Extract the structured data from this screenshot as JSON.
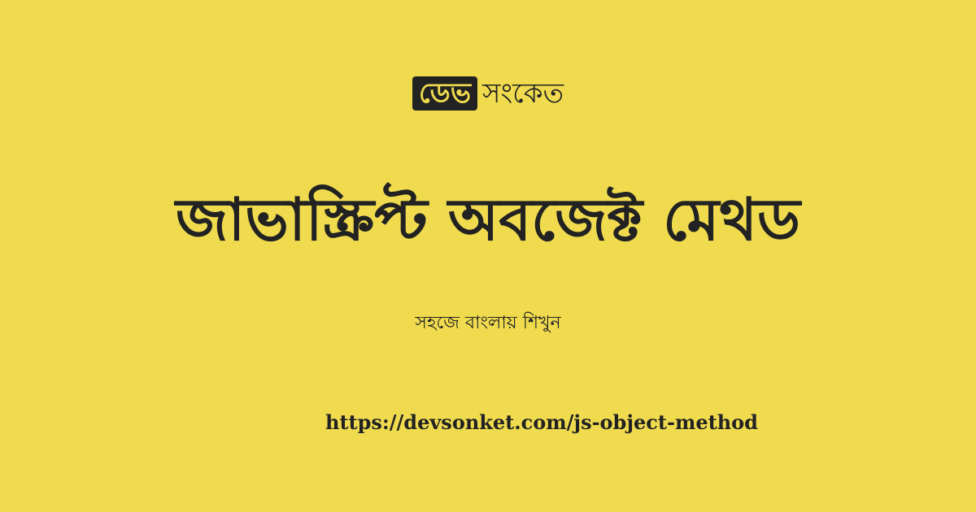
{
  "brand": {
    "badge": "ডেভ",
    "name": "সংকেত"
  },
  "title": "জাভাস্ক্রিপ্ট অবজেক্ট মেথড",
  "subtitle": "সহজে বাংলায় শিখুন",
  "url": "https://devsonket.com/js-object-method",
  "colors": {
    "background": "#f0db4f",
    "text": "#222222",
    "badge_text": "#f0db4f"
  }
}
